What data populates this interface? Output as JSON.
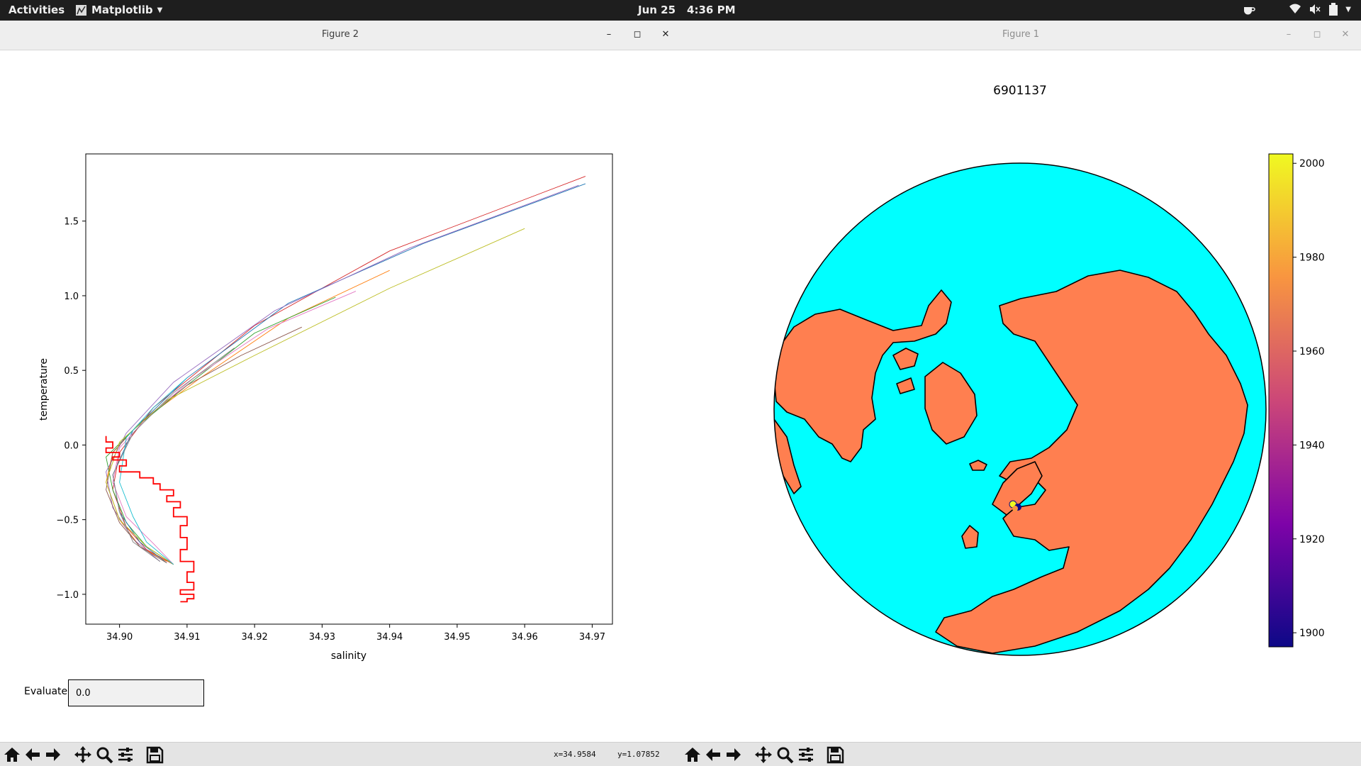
{
  "topbar": {
    "activities": "Activities",
    "app_name": "Matplotlib",
    "date": "Jun 25",
    "time": "4:36 PM"
  },
  "figure2": {
    "window_title": "Figure 2",
    "evaluate_label": "Evaluate",
    "evaluate_value": "0.0",
    "status_x": "x=34.9584",
    "status_y": "y=1.07852"
  },
  "figure1": {
    "window_title": "Figure 1",
    "map_title": "6901137"
  },
  "colors": {
    "ocean": "#00ffff",
    "land": "#ff7f50",
    "highlight_profile": "#ff0000"
  },
  "chart_data": [
    {
      "type": "line",
      "xlabel": "salinity",
      "ylabel": "temperature",
      "xlim": [
        34.895,
        34.973
      ],
      "ylim": [
        -1.2,
        1.95
      ],
      "xticks": [
        34.9,
        34.91,
        34.92,
        34.93,
        34.94,
        34.95,
        34.96,
        34.97
      ],
      "xtick_labels": [
        "34.90",
        "34.91",
        "34.92",
        "34.93",
        "34.94",
        "34.95",
        "34.96",
        "34.97"
      ],
      "yticks": [
        -1.0,
        -0.5,
        0.0,
        0.5,
        1.0,
        1.5
      ],
      "ytick_labels": [
        "−1.0",
        "−0.5",
        "0.0",
        "0.5",
        "1.0",
        "1.5"
      ],
      "series": [
        {
          "color": "#d62728",
          "x": [
            34.969,
            34.94,
            34.92,
            34.905,
            34.9,
            34.899,
            34.901,
            34.904,
            34.908
          ],
          "y": [
            1.8,
            1.3,
            0.8,
            0.25,
            -0.05,
            -0.3,
            -0.55,
            -0.7,
            -0.8
          ]
        },
        {
          "color": "#ff7f0e",
          "x": [
            34.94,
            34.925,
            34.912,
            34.903,
            34.899,
            34.898,
            34.9,
            34.903,
            34.907
          ],
          "y": [
            1.17,
            0.85,
            0.45,
            0.15,
            -0.05,
            -0.25,
            -0.5,
            -0.68,
            -0.78
          ]
        },
        {
          "color": "#2ca02c",
          "x": [
            34.932,
            34.92,
            34.91,
            34.902,
            34.898,
            34.899,
            34.901,
            34.904,
            34.908
          ],
          "y": [
            0.99,
            0.75,
            0.4,
            0.1,
            -0.08,
            -0.3,
            -0.52,
            -0.68,
            -0.8
          ]
        },
        {
          "color": "#1f77b4",
          "x": [
            34.969,
            34.945,
            34.925,
            34.91,
            34.902,
            34.899,
            34.9,
            34.903,
            34.907
          ],
          "y": [
            1.75,
            1.35,
            0.95,
            0.45,
            0.1,
            -0.2,
            -0.45,
            -0.65,
            -0.79
          ]
        },
        {
          "color": "#9467bd",
          "x": [
            34.968,
            34.943,
            34.923,
            34.908,
            34.901,
            34.898,
            34.899,
            34.902,
            34.906
          ],
          "y": [
            1.74,
            1.32,
            0.9,
            0.42,
            0.08,
            -0.18,
            -0.42,
            -0.63,
            -0.78
          ]
        },
        {
          "color": "#8c564b",
          "x": [
            34.927,
            34.918,
            34.91,
            34.903,
            34.899,
            34.898,
            34.9,
            34.903,
            34.907
          ],
          "y": [
            0.79,
            0.6,
            0.4,
            0.15,
            -0.05,
            -0.3,
            -0.52,
            -0.68,
            -0.79
          ]
        },
        {
          "color": "#e377c2",
          "x": [
            34.935,
            34.922,
            34.911,
            34.904,
            34.9,
            34.899,
            34.901,
            34.905,
            34.908
          ],
          "y": [
            1.03,
            0.78,
            0.45,
            0.18,
            -0.02,
            -0.25,
            -0.48,
            -0.66,
            -0.8
          ]
        },
        {
          "color": "#bcbd22",
          "x": [
            34.96,
            34.94,
            34.92,
            34.907,
            34.9,
            34.898,
            34.9,
            34.904,
            34.908
          ],
          "y": [
            1.45,
            1.05,
            0.6,
            0.3,
            0.02,
            -0.25,
            -0.5,
            -0.68,
            -0.8
          ]
        },
        {
          "color": "#17becf",
          "x": [
            34.91,
            34.905,
            34.901,
            34.9,
            34.902,
            34.904,
            34.908
          ],
          "y": [
            0.45,
            0.25,
            0.05,
            -0.25,
            -0.48,
            -0.65,
            -0.8
          ]
        },
        {
          "color": "#7f7f7f",
          "x": [
            34.917,
            34.908,
            34.902,
            34.899,
            34.9,
            34.902,
            34.906
          ],
          "y": [
            0.65,
            0.35,
            0.08,
            -0.2,
            -0.45,
            -0.65,
            -0.78
          ]
        },
        {
          "color": "#ff0000",
          "x": [
            34.898,
            34.899,
            34.898,
            34.9,
            34.899,
            34.901,
            34.9,
            34.903,
            34.905,
            34.906,
            34.908,
            34.907,
            34.909,
            34.908,
            34.91,
            34.909,
            34.91,
            34.909,
            34.911,
            34.91,
            34.911,
            34.909,
            34.911,
            34.91,
            34.909
          ],
          "y": [
            0.06,
            0.02,
            -0.02,
            -0.05,
            -0.08,
            -0.1,
            -0.14,
            -0.18,
            -0.22,
            -0.26,
            -0.3,
            -0.34,
            -0.38,
            -0.42,
            -0.48,
            -0.54,
            -0.62,
            -0.7,
            -0.78,
            -0.85,
            -0.92,
            -0.97,
            -1.0,
            -1.03,
            -1.05
          ]
        }
      ]
    },
    {
      "type": "heatmap",
      "title": "6901137",
      "colorbar": {
        "min": 1897,
        "max": 2002,
        "ticks": [
          1900,
          1920,
          1940,
          1960,
          1980,
          2000
        ],
        "tick_labels": [
          "1900",
          "1920",
          "1940",
          "1960",
          "1980",
          "2000"
        ],
        "colormap": "plasma"
      }
    }
  ]
}
